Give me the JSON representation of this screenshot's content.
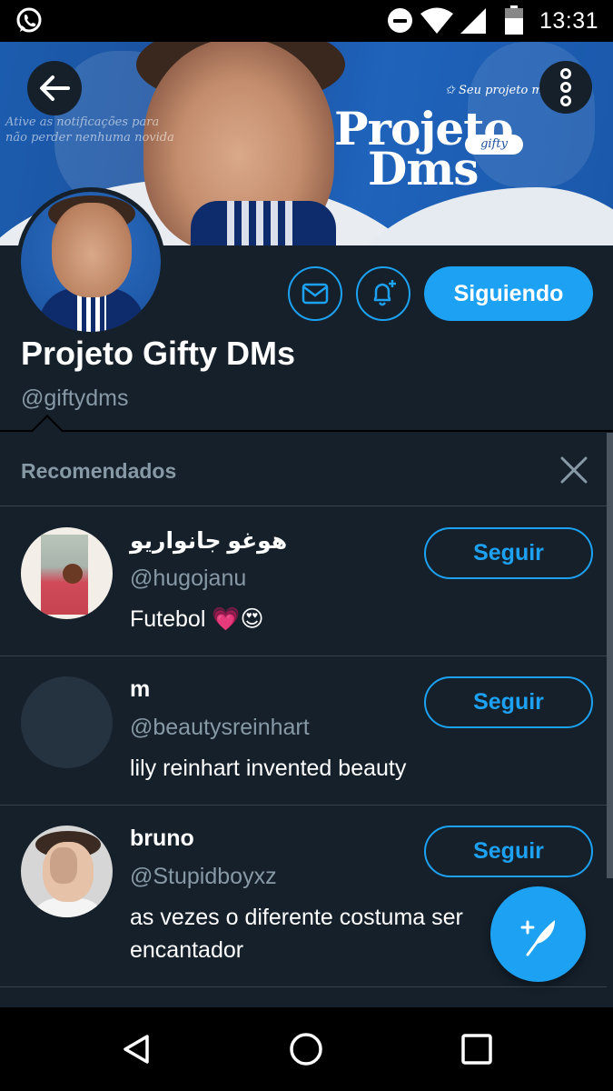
{
  "status_bar": {
    "time": "13:31",
    "icons": [
      "whatsapp-icon",
      "do-not-disturb-icon",
      "wifi-icon",
      "signal-icon",
      "battery-icon"
    ]
  },
  "banner": {
    "notify_text_line1": "Ative as notificações para",
    "notify_text_line2": "não perder nenhuma novida",
    "tagline": "✩ Seu projeto mix e gui",
    "logo_line1": "Projeto",
    "logo_line2": "Dms",
    "logo_tag": "gifty"
  },
  "profile": {
    "display_name": "Projeto Gifty DMs",
    "handle": "@giftydms",
    "following_label": "Siguiendo"
  },
  "recommendations": {
    "title": "Recomendados",
    "follow_label": "Seguir",
    "items": [
      {
        "name": "هوغو جانواريو",
        "handle": "@hugojanu",
        "bio": "Futebol 💗😍"
      },
      {
        "name": "m",
        "handle": "@beautysreinhart",
        "bio": "lily reinhart invented beauty"
      },
      {
        "name": "bruno",
        "handle": "@Stupidboyxz",
        "bio": "as vezes o diferente costuma ser encantador"
      }
    ]
  },
  "colors": {
    "background": "#15202b",
    "accent": "#1da1f2",
    "secondary_text": "#8899a6",
    "divider": "#38444d"
  }
}
